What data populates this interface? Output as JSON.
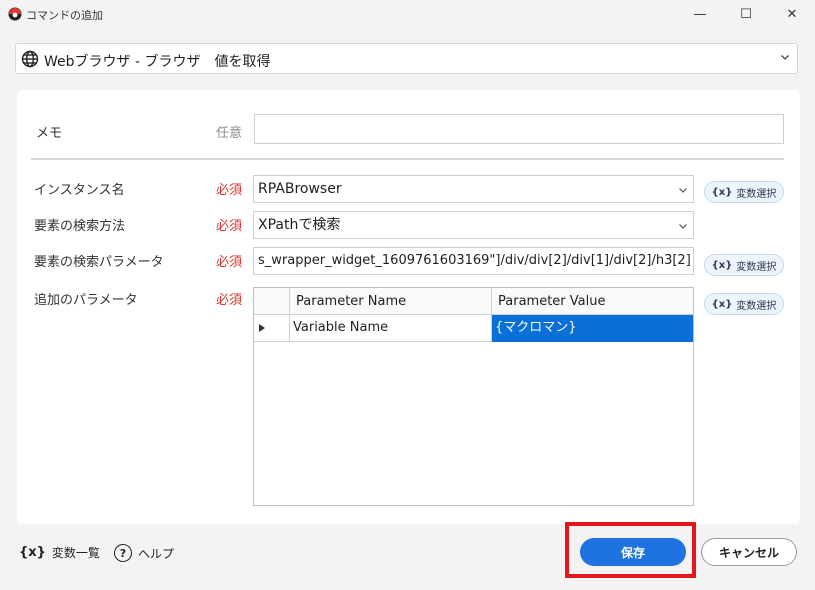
{
  "window": {
    "title": "コマンドの追加",
    "minimize": "—",
    "maximize": "☐",
    "close": "✕"
  },
  "command_selector": {
    "icon": "globe-icon",
    "value": "Webブラウザ - ブラウザ　値を取得"
  },
  "form": {
    "memo": {
      "label": "メモ",
      "tag": "任意",
      "value": ""
    },
    "instance": {
      "label": "インスタンス名",
      "tag": "必須",
      "value": "RPABrowser"
    },
    "search_method": {
      "label": "要素の検索方法",
      "tag": "必須",
      "value": "XPathで検索"
    },
    "search_param": {
      "label": "要素の検索パラメータ",
      "tag": "必須",
      "value": "s_wrapper_widget_1609761603169\"]/div/div[2]/div[1]/div[2]/h3[2]"
    },
    "extra_params": {
      "label": "追加のパラメータ",
      "tag": "必須"
    },
    "var_select_label": "変数選択",
    "var_icon_text": "{x}"
  },
  "grid": {
    "columns": [
      "Parameter Name",
      "Parameter Value"
    ],
    "rows": [
      {
        "name": "Variable Name",
        "value": "{マクロマン}"
      }
    ]
  },
  "footer": {
    "var_list_icon": "{x}",
    "var_list": "変数一覧",
    "help_icon": "?",
    "help": "ヘルプ",
    "save": "保存",
    "cancel": "キャンセル"
  },
  "colors": {
    "accent": "#1e73e0",
    "required": "#d9362d",
    "selection": "#0a6fd6",
    "highlight": "#e4161b"
  }
}
